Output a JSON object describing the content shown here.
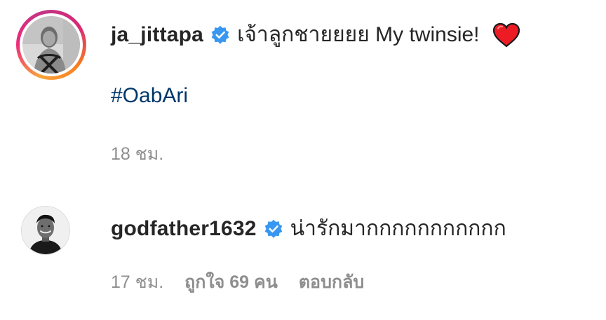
{
  "comments": [
    {
      "username": "ja_jittapa",
      "text": "เจ้าลูกชายยยย My twinsie!",
      "emoji": "red-heart",
      "hashtag": "#OabAri",
      "time": "18 ชม."
    },
    {
      "username": "godfather1632",
      "text": "น่ารักมากกกกกกกกกกก",
      "time": "17 ชม.",
      "likes": "ถูกใจ 69 คน",
      "reply_label": "ตอบกลับ"
    }
  ],
  "colors": {
    "text": "#262626",
    "muted": "#8e8e8e",
    "hashtag": "#00376b",
    "verified": "#3897f0",
    "heart": "#ed1c24"
  }
}
